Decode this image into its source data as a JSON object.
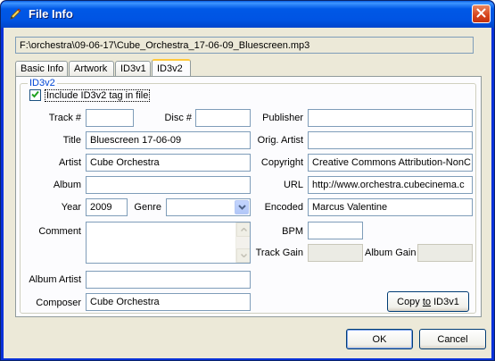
{
  "window": {
    "title": "File Info",
    "file_path": "F:\\orchestra\\09-06-17\\Cube_Orchestra_17-06-09_Bluescreen.mp3"
  },
  "tabs": [
    {
      "label": "Basic Info",
      "active": false
    },
    {
      "label": "Artwork",
      "active": false
    },
    {
      "label": "ID3v1",
      "active": false
    },
    {
      "label": "ID3v2",
      "active": true
    }
  ],
  "group": {
    "legend": "ID3v2",
    "include_tag_label": "Include ID3v2 tag in file",
    "include_tag_checked": true
  },
  "fields": {
    "track_label": "Track #",
    "track_value": "",
    "disc_label": "Disc #",
    "disc_value": "",
    "title_label": "Title",
    "title_value": "Bluescreen 17-06-09",
    "artist_label": "Artist",
    "artist_value": "Cube Orchestra",
    "album_label": "Album",
    "album_value": "",
    "year_label": "Year",
    "year_value": "2009",
    "genre_label": "Genre",
    "genre_value": "",
    "comment_label": "Comment",
    "comment_value": "",
    "album_artist_label": "Album Artist",
    "album_artist_value": "",
    "composer_label": "Composer",
    "composer_value": "Cube Orchestra",
    "publisher_label": "Publisher",
    "publisher_value": "",
    "orig_artist_label": "Orig. Artist",
    "orig_artist_value": "",
    "copyright_label": "Copyright",
    "copyright_value": "Creative Commons Attribution-NonC",
    "url_label": "URL",
    "url_value": "http://www.orchestra.cubecinema.c",
    "encoded_label": "Encoded",
    "encoded_value": "Marcus Valentine",
    "bpm_label": "BPM",
    "bpm_value": "",
    "track_gain_label": "Track Gain",
    "track_gain_value": "",
    "album_gain_label": "Album Gain",
    "album_gain_value": ""
  },
  "buttons": {
    "copy_prefix": "Copy ",
    "copy_underlined": "to",
    "copy_suffix": " ID3v1",
    "ok": "OK",
    "cancel": "Cancel"
  },
  "icons": {
    "app": "pencil-icon",
    "close": "close-icon",
    "check": "checkmark-icon",
    "dropdown": "chevron-down-icon"
  }
}
